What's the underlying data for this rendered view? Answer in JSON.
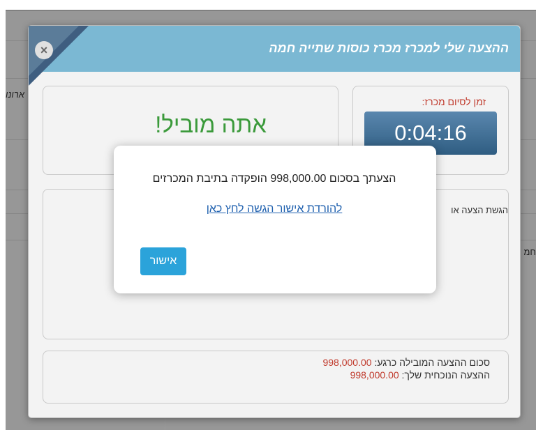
{
  "background": {
    "left_fragment": "ארונו",
    "right_fragment": "חמ"
  },
  "modal": {
    "title": "ההצעה שלי למכרז מכרז כוסות שתייה חמה",
    "close_icon": "close-icon",
    "leading_text": "אתה מוביל!",
    "timer_label": "זמן לסיום מכרז:",
    "timer_value": "0:04:16",
    "bid_label": "הגשת הצעה או",
    "summary": {
      "leading_label": "סכום ההצעה המובילה כרגע:",
      "leading_value": "998,000.00",
      "current_label": "ההצעה הנוכחית שלך:",
      "current_value": "998,000.00"
    }
  },
  "alert": {
    "message": "הצעתך בסכום 998,000.00 הופקדה בתיבת המכרזים",
    "link_text": "להורדת אישור הגשה לחץ כאן",
    "ok_label": "אישור"
  }
}
